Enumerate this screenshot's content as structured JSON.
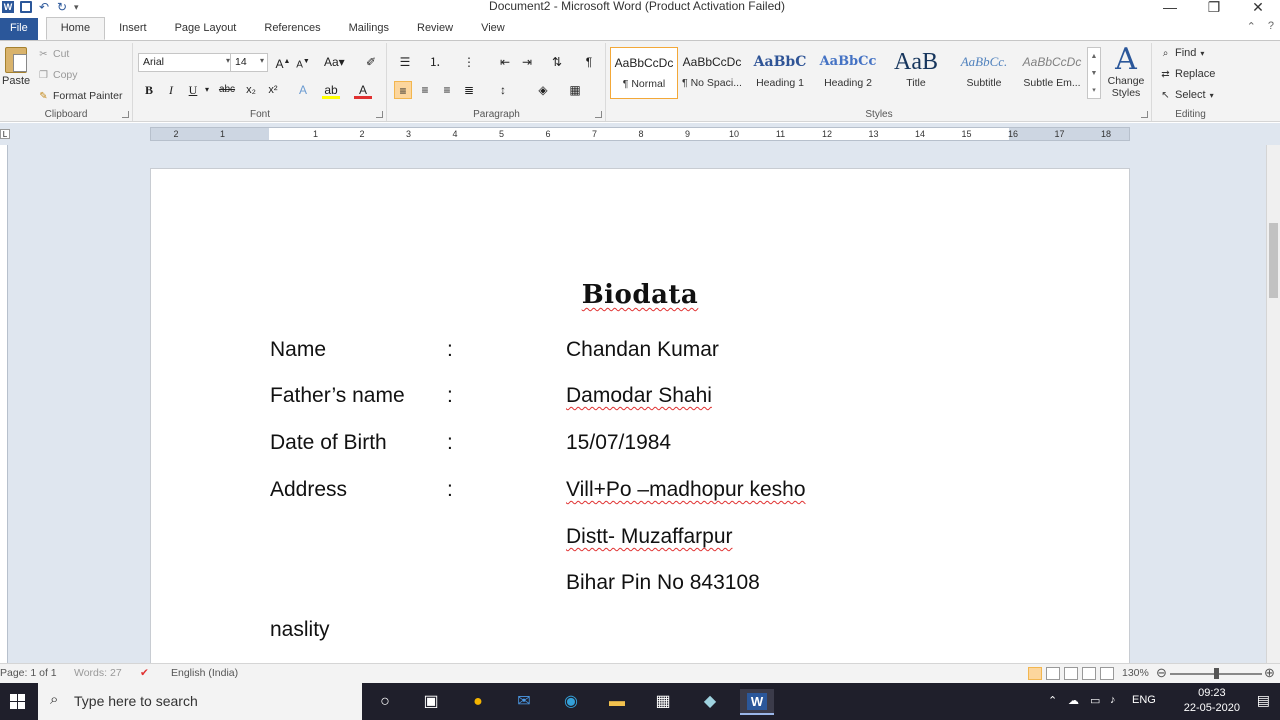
{
  "window": {
    "title": "Document2 - Microsoft Word (Product Activation Failed)",
    "minimize": "—",
    "restore": "❐",
    "close": "✕"
  },
  "tabs": [
    {
      "label": "File"
    },
    {
      "label": "Home"
    },
    {
      "label": "Insert"
    },
    {
      "label": "Page Layout"
    },
    {
      "label": "References"
    },
    {
      "label": "Mailings"
    },
    {
      "label": "Review"
    },
    {
      "label": "View"
    }
  ],
  "ribbon": {
    "clipboard": {
      "paste": "Paste",
      "cut": "Cut",
      "copy": "Copy",
      "format_painter": "Format Painter",
      "group_label": "Clipboard"
    },
    "font": {
      "font_name": "Arial",
      "font_size": "14",
      "group_label": "Font"
    },
    "paragraph": {
      "group_label": "Paragraph"
    },
    "styles": {
      "group_label": "Styles",
      "items": [
        {
          "sample": "AaBbCcDc",
          "name": "¶ Normal"
        },
        {
          "sample": "AaBbCcDc",
          "name": "¶ No Spaci..."
        },
        {
          "sample": "AaBbC",
          "name": "Heading 1"
        },
        {
          "sample": "AaBbCc",
          "name": "Heading 2"
        },
        {
          "sample": "AaB",
          "name": "Title"
        },
        {
          "sample": "AaBbCc.",
          "name": "Subtitle"
        },
        {
          "sample": "AaBbCcDc",
          "name": "Subtle Em..."
        }
      ],
      "change_styles": "Change Styles"
    },
    "editing": {
      "group_label": "Editing",
      "find": "Find",
      "replace": "Replace",
      "select": "Select"
    }
  },
  "ruler": {
    "ticks": [
      "2",
      "1",
      "1",
      "2",
      "3",
      "4",
      "5",
      "6",
      "7",
      "8",
      "9",
      "10",
      "11",
      "12",
      "13",
      "14",
      "15",
      "16",
      "17",
      "18"
    ]
  },
  "document": {
    "title": "Biodata",
    "rows": [
      {
        "label": "Name",
        "colon": ":",
        "value": "Chandan  Kumar"
      },
      {
        "label": "Father’s  name",
        "colon": ":",
        "value": "Damodar  Shahi"
      },
      {
        "label": "Date of Birth",
        "colon": ":",
        "value": "15/07/1984"
      },
      {
        "label": "Address",
        "colon": ":",
        "value": "Vill+Po  –madhopur  kesho"
      },
      {
        "label": "",
        "colon": "",
        "value": "Distt-  Muzaffarpur"
      },
      {
        "label": "",
        "colon": "",
        "value": "Bihar  Pin No  843108"
      },
      {
        "label": "naslity",
        "colon": "",
        "value": ""
      }
    ]
  },
  "statusbar": {
    "page": "Page: 1 of 1",
    "words": "Words: 27",
    "language": "English (India)",
    "zoom": "130%",
    "zoom_level": 0.5
  },
  "taskbar": {
    "search_placeholder": "Type here to search",
    "language": "ENG",
    "time": "09:23",
    "date": "22-05-2020"
  },
  "colors": {
    "word_blue": "#2b579a",
    "ribbon_bg": "#f3f3f3",
    "selected_style": "#fcd69d",
    "spell_error": "#e03131",
    "taskbar_bg": "#1f1f2b"
  }
}
